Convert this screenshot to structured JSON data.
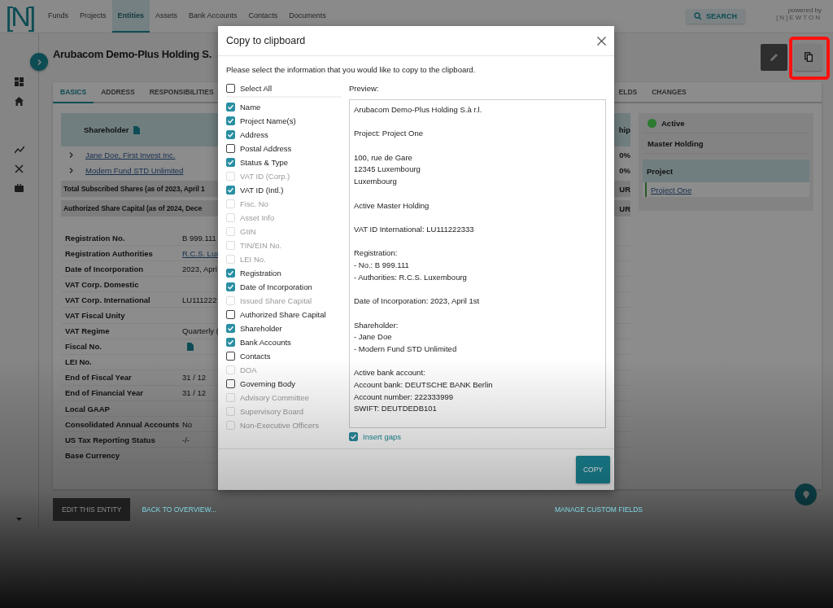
{
  "nav": {
    "logo": "[N]",
    "search": "SEARCH",
    "powered_by": "powered by",
    "brand": "[N]EWTON",
    "items": [
      {
        "label": "Funds",
        "selected": false
      },
      {
        "label": "Projects",
        "selected": false
      },
      {
        "label": "Entities",
        "selected": true
      },
      {
        "label": "Assets",
        "selected": false
      },
      {
        "label": "Bank Accounts",
        "selected": false
      },
      {
        "label": "Contacts",
        "selected": false
      },
      {
        "label": "Documents",
        "selected": false
      }
    ]
  },
  "entity": {
    "title": "Arubacom Demo-Plus Holding S.",
    "tabs": [
      {
        "label": "BASICS",
        "selected": true
      },
      {
        "label": "ADDRESS",
        "selected": false
      },
      {
        "label": "RESPONSIBILITIES",
        "selected": false
      },
      {
        "label": "ELDS",
        "selected": false
      },
      {
        "label": "CHANGES",
        "selected": false
      }
    ],
    "shareholder_table": {
      "heading": "Shareholder",
      "heading_end": "hip",
      "rows": [
        {
          "kind": "link",
          "text": "Jane Doe, First Invest Inc.",
          "end": "0%"
        },
        {
          "kind": "link",
          "text": "Modern Fund STD Unlimited",
          "end": "0%"
        },
        {
          "kind": "total",
          "text": "Total Subscribed Shares (as of 2023, April 1",
          "end": "UR"
        },
        {
          "kind": "total",
          "text": "Authorized Share Capital (as of 2024, Dece",
          "end": "UR"
        }
      ]
    },
    "details": [
      {
        "label": "Registration No.",
        "kind": "text",
        "value": "B 999.111"
      },
      {
        "label": "Registration Authorities",
        "kind": "link",
        "value": "R.C.S. Lux"
      },
      {
        "label": "Date of Incorporation",
        "kind": "text",
        "value": "2023, Apri"
      },
      {
        "label": "VAT Corp. Domestic",
        "kind": "empty"
      },
      {
        "label": "VAT Corp. International",
        "kind": "text",
        "value": "LU111222"
      },
      {
        "label": "VAT Fiscal Unity",
        "kind": "empty"
      },
      {
        "label": "VAT Regime",
        "kind": "text",
        "value": "Quarterly ("
      },
      {
        "label": "Fiscal No.",
        "kind": "document"
      },
      {
        "label": "LEI No.",
        "kind": "empty"
      },
      {
        "label": "End of Fiscal Year",
        "kind": "text",
        "value": "31 / 12"
      },
      {
        "label": "End of Financial Year",
        "kind": "text",
        "value": "31 / 12"
      },
      {
        "label": "Local GAAP",
        "kind": "empty"
      },
      {
        "label": "Consolidated Annual Accounts",
        "kind": "text",
        "value": "No"
      },
      {
        "label": "US Tax Reporting Status",
        "kind": "text",
        "value": "-/-"
      },
      {
        "label": "Base Currency",
        "kind": "empty"
      }
    ],
    "status": {
      "label": "Active",
      "color": "#2a7a2f"
    },
    "type": "Master Holding",
    "project": {
      "heading": "Project",
      "link": "Project One"
    },
    "edit_button": "EDIT THIS ENTITY",
    "back_link": "BACK TO OVERVIEW...",
    "custom_fields_link": "MANAGE CUSTOM FIELDS"
  },
  "modal": {
    "title": "Copy to clipboard",
    "intro": "Please select the information that you would like to copy to the clipboard.",
    "select_all": {
      "label": "Select All",
      "checked": false
    },
    "options": [
      {
        "label": "Name",
        "checked": true,
        "disabled": false
      },
      {
        "label": "Project Name(s)",
        "checked": true,
        "disabled": false
      },
      {
        "label": "Address",
        "checked": true,
        "disabled": false
      },
      {
        "label": "Postal Address",
        "checked": false,
        "disabled": false
      },
      {
        "label": "Status & Type",
        "checked": true,
        "disabled": false
      },
      {
        "label": "VAT ID (Corp.)",
        "checked": false,
        "disabled": true
      },
      {
        "label": "VAT ID (Intl.)",
        "checked": true,
        "disabled": false
      },
      {
        "label": "Fisc. No",
        "checked": false,
        "disabled": true
      },
      {
        "label": "Asset Info",
        "checked": false,
        "disabled": true
      },
      {
        "label": "GIIN",
        "checked": false,
        "disabled": true
      },
      {
        "label": "TIN/EIN No.",
        "checked": false,
        "disabled": true
      },
      {
        "label": "LEI No.",
        "checked": false,
        "disabled": true
      },
      {
        "label": "Registration",
        "checked": true,
        "disabled": false
      },
      {
        "label": "Date of Incorporation",
        "checked": true,
        "disabled": false
      },
      {
        "label": "Issued Share Capital",
        "checked": false,
        "disabled": true
      },
      {
        "label": "Authorized Share Capital",
        "checked": false,
        "disabled": false
      },
      {
        "label": "Shareholder",
        "checked": true,
        "disabled": false
      },
      {
        "label": "Bank Accounts",
        "checked": true,
        "disabled": false
      },
      {
        "label": "Contacts",
        "checked": false,
        "disabled": false
      },
      {
        "label": "DOA",
        "checked": false,
        "disabled": true
      },
      {
        "label": "Governing Body",
        "checked": false,
        "disabled": false
      },
      {
        "label": "Advisory Committee",
        "checked": false,
        "disabled": true
      },
      {
        "label": "Supervisory Board",
        "checked": false,
        "disabled": true
      },
      {
        "label": "Non-Executive Officers",
        "checked": false,
        "disabled": true
      }
    ],
    "preview_label": "Preview:",
    "preview": [
      [
        "Arubacom Demo-Plus Holding S.à r.l."
      ],
      [
        "Project: Project One"
      ],
      [
        "100, rue de Gare",
        "12345 Luxembourg",
        "Luxembourg"
      ],
      [
        "Active Master Holding"
      ],
      [
        "VAT ID International: LU111222333"
      ],
      [
        "Registration:",
        "- No.: B 999.111",
        "- Authorities: R.C.S. Luxembourg"
      ],
      [
        "Date of Incorporation: 2023, April 1st"
      ],
      [
        "Shareholder:",
        "- Jane Doe",
        "- Modern Fund STD Unlimited"
      ],
      [
        "Active bank account:",
        "Account bank: DEUTSCHE BANK Berlin",
        "Account number: 222333999",
        "SWIFT: DEUTDEDB101"
      ]
    ],
    "insert_gaps": {
      "label": "Insert gaps",
      "checked": true
    },
    "copy_button": "COPY"
  }
}
